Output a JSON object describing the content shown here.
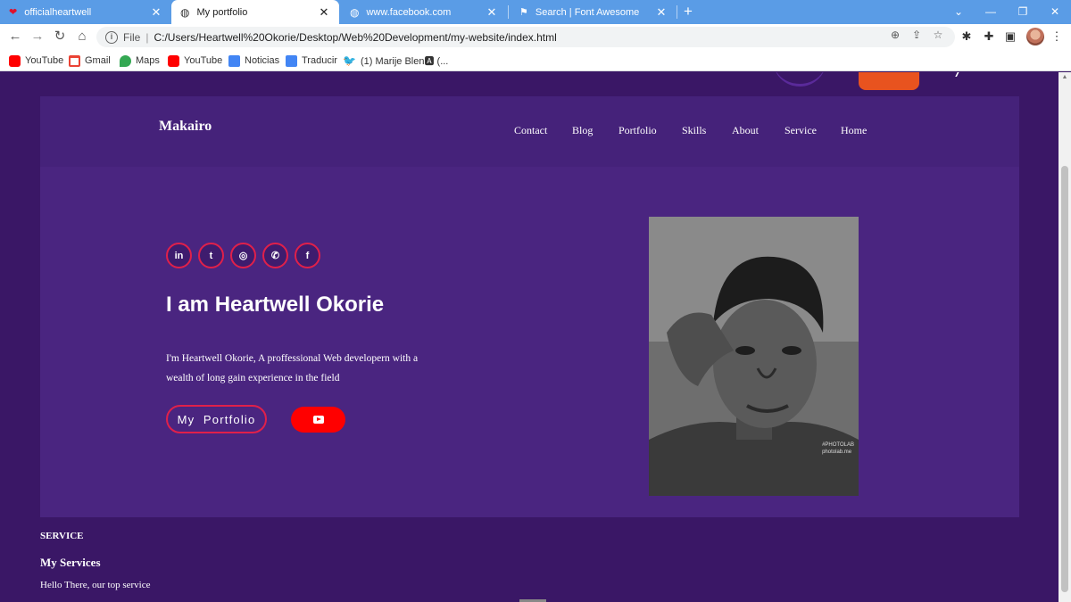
{
  "browser": {
    "tabs": [
      {
        "title": "officialheartwell",
        "active": false
      },
      {
        "title": "My portfolio",
        "active": true
      },
      {
        "title": "www.facebook.com",
        "active": false
      },
      {
        "title": "Search | Font Awesome",
        "active": false
      }
    ],
    "new_tab": "+",
    "close": "✕",
    "address": {
      "prefix": "File",
      "url": "C:/Users/Heartwell%20Okorie/Desktop/Web%20Development/my-website/index.html"
    },
    "bookmarks": [
      {
        "label": "YouTube",
        "color": "#ff0000"
      },
      {
        "label": "Gmail",
        "color": "#ea4335"
      },
      {
        "label": "Maps",
        "color": "#34a853"
      },
      {
        "label": "YouTube",
        "color": "#ff0000"
      },
      {
        "label": "Noticias",
        "color": "#4285f4"
      },
      {
        "label": "Traducir",
        "color": "#4285f4"
      },
      {
        "label": "(1) Marije Blen🅰 (...",
        "color": "#1da1f2"
      }
    ]
  },
  "page": {
    "brand": "Makairo",
    "nav": [
      "Contact",
      "Blog",
      "Portfolio",
      "Skills",
      "About",
      "Service",
      "Home"
    ],
    "socials": [
      {
        "name": "linkedin",
        "glyph": "in"
      },
      {
        "name": "twitter",
        "glyph": "t"
      },
      {
        "name": "instagram",
        "glyph": "◎"
      },
      {
        "name": "whatsapp",
        "glyph": "✆"
      },
      {
        "name": "facebook",
        "glyph": "f"
      }
    ],
    "hero_title": "I am Heartwell Okorie",
    "hero_desc": "I'm Heartwell Okorie, A proffessional Web developern with a wealth of long gain experience in the field",
    "portfolio_button": "My  Portfolio",
    "photo_label_1": "#PHOTOLAB",
    "photo_label_2": "photolab.me",
    "service_eyebrow": "SERVICE",
    "service_title": "My Services",
    "service_desc": "Hello There, our top service"
  },
  "colors": {
    "page_bg": "#3a1766",
    "hero_bg": "#4a2580",
    "accent_red": "#e0204a",
    "youtube_red": "#ff0000"
  }
}
